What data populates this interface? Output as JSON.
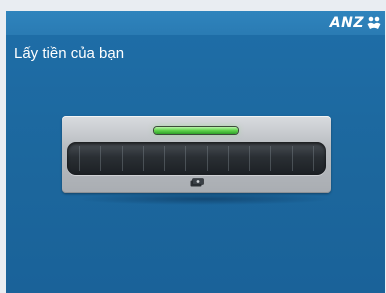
{
  "header": {
    "brand": "ANZ"
  },
  "main": {
    "prompt": "Lấy tiền của bạn"
  },
  "dispenser": {
    "status_light": "on",
    "icon": "cash-icon"
  },
  "colors": {
    "background": "#1c679d",
    "header": "#2f84bd",
    "status_light": "#5fd34a"
  }
}
